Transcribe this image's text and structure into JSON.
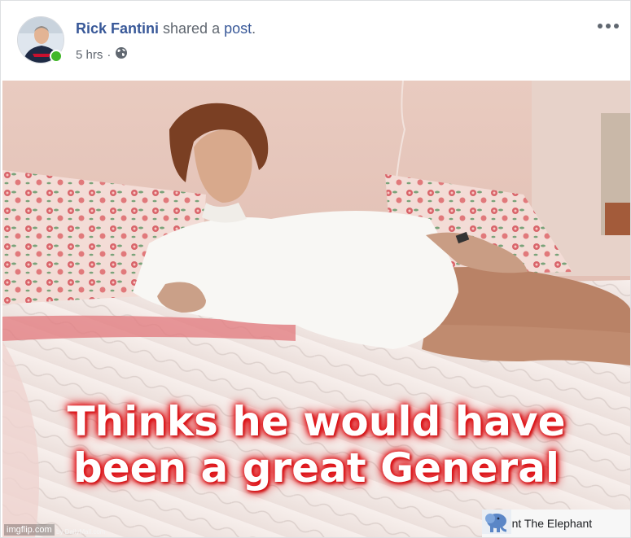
{
  "post": {
    "author": "Rick Fantini",
    "action_text": "shared a",
    "action_link": "post",
    "period": ".",
    "time": "5 hrs",
    "separator": "·",
    "privacy_icon": "globe-icon",
    "more_icon": "more-horizontal-icon",
    "online": true
  },
  "image": {
    "caption_line1": "Thinks he would have",
    "caption_line2": "been a great General",
    "watermark": "imgflip.com",
    "credit": "by DailyMail.com",
    "source_name": "Taunt The Elephant",
    "source_icon": "elephant-logo-icon"
  },
  "colors": {
    "link": "#385898",
    "meta": "#606770",
    "online": "#42b72a",
    "caption_glow": "#e0151a"
  }
}
